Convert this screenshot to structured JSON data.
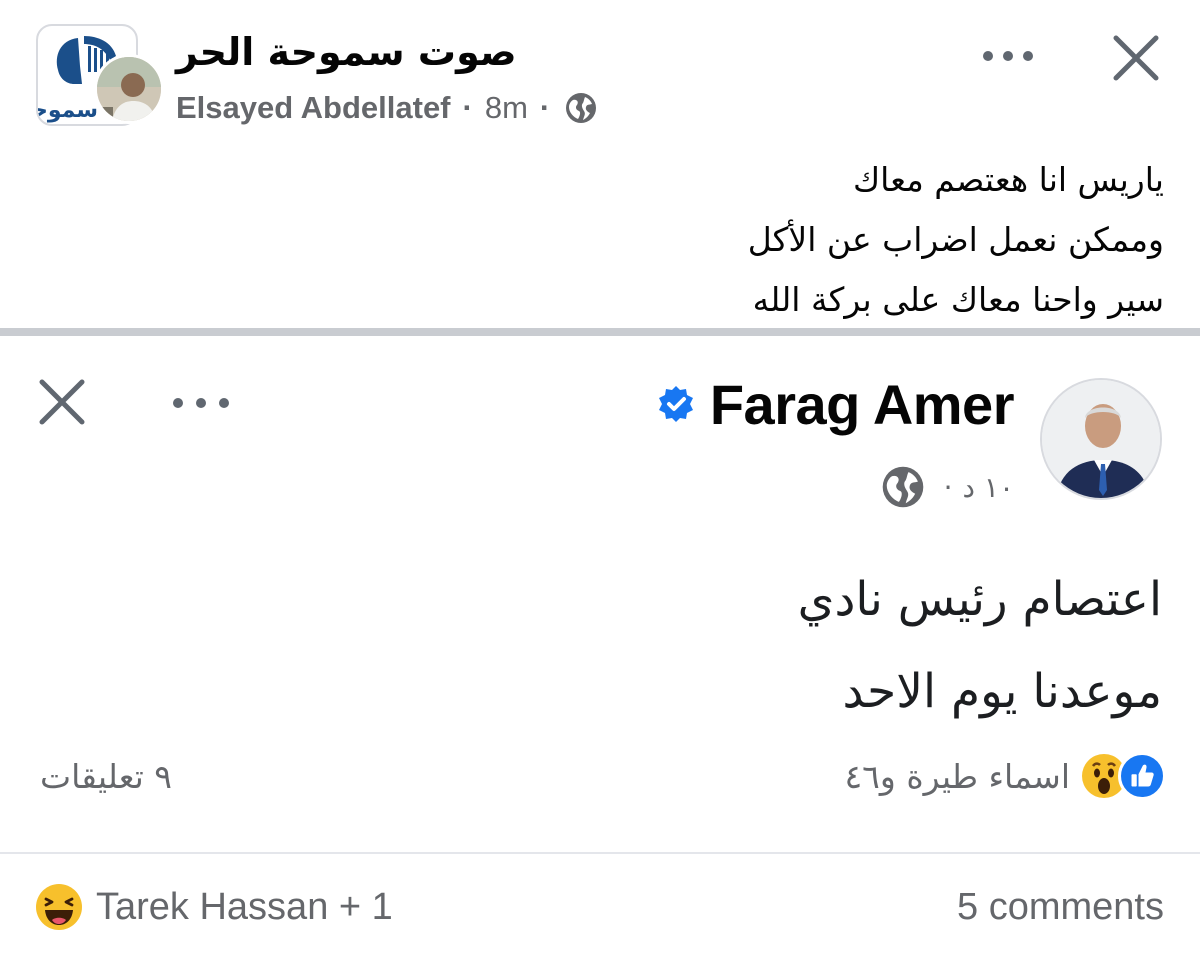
{
  "post": {
    "page_name": "صوت سموحة الحر",
    "page_avatar_text": "سموحة",
    "author": "Elsayed Abdellatef",
    "separator": "·",
    "time": "8m",
    "privacy_icon": "globe-icon",
    "text_lines": [
      "ياريس انا هعتصم معاك",
      "وممكن نعمل اضراب عن الأكل",
      "سير واحنا معاك على بركة الله"
    ]
  },
  "shared": {
    "author": "Farag Amer",
    "verified_icon": "verified-badge-icon",
    "time": "١٠ د",
    "separator": "·",
    "body_lines": [
      "اعتصام رئيس نادي",
      "موعدنا  يوم الاحد"
    ],
    "reactions_text": "اسماء طيرة و٤٦",
    "reaction_icons": [
      "like-icon",
      "wow-icon"
    ],
    "comments_text": "٩ تعليقات"
  },
  "footer": {
    "reactions_text": "Tarek Hassan + 1",
    "reaction_icon": "haha-icon",
    "comments_text": "5 comments"
  },
  "colors": {
    "facebook_blue": "#1877f2",
    "secondary_text": "#65676b",
    "primary_text": "#050505",
    "divider": "#c9ccd1"
  }
}
